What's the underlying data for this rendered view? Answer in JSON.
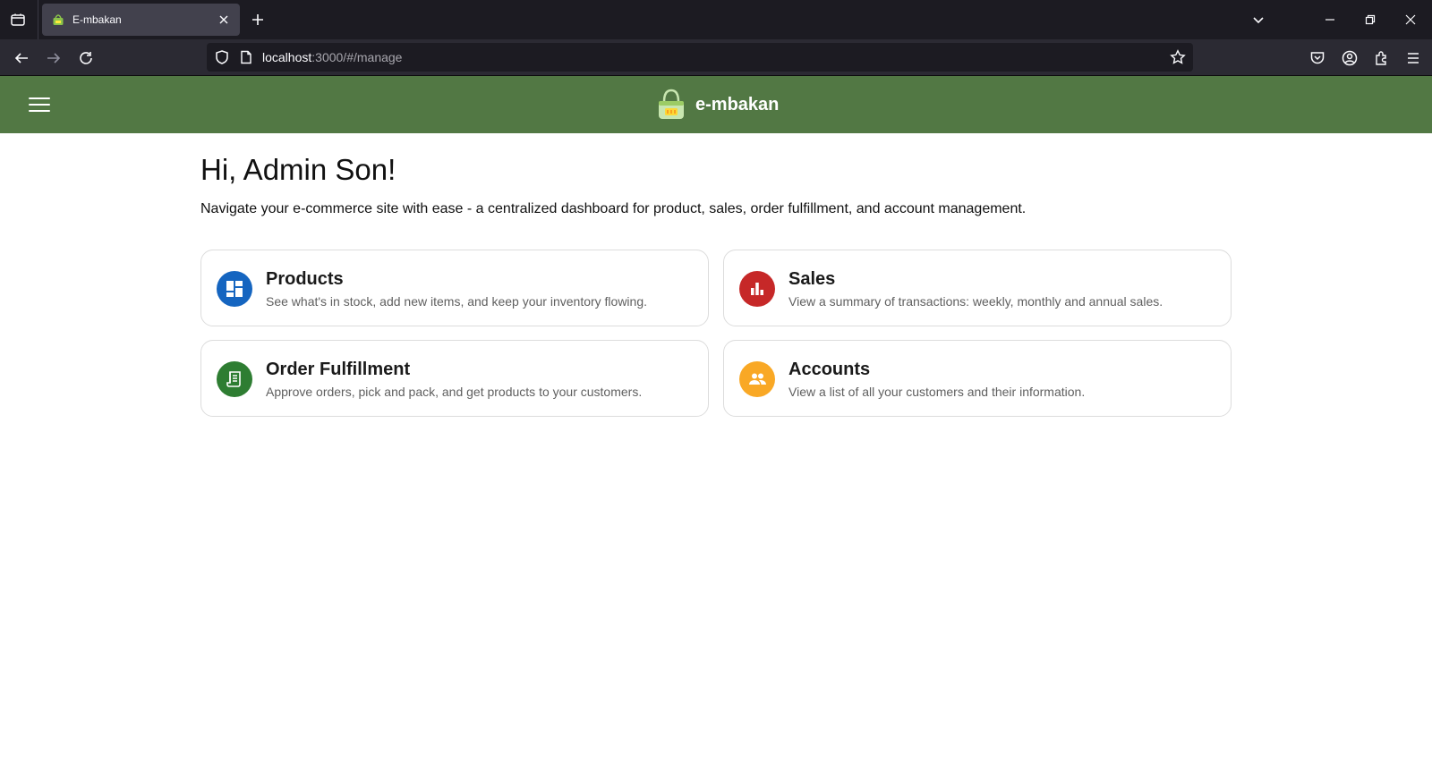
{
  "browser": {
    "tab": {
      "title": "E-mbakan"
    },
    "url": {
      "host": "localhost",
      "rest": ":3000/#/manage"
    }
  },
  "header": {
    "brand": "e-mbakan",
    "accent": "#527844"
  },
  "main": {
    "greeting": "Hi, Admin Son!",
    "subtitle": "Navigate your e-commerce site with ease - a centralized dashboard for product, sales, order fulfillment, and account management.",
    "cards": [
      {
        "title": "Products",
        "desc": "See what's in stock, add new items, and keep your inventory flowing.",
        "icon": "dashboard-icon",
        "color": "#1565c0"
      },
      {
        "title": "Sales",
        "desc": "View a summary of transactions: weekly, monthly and annual sales.",
        "icon": "bar-chart-icon",
        "color": "#c62828"
      },
      {
        "title": "Order Fulfillment",
        "desc": "Approve orders, pick and pack, and get products to your customers.",
        "icon": "receipt-icon",
        "color": "#2e7d32"
      },
      {
        "title": "Accounts",
        "desc": "View a list of all your customers and their information.",
        "icon": "people-icon",
        "color": "#f9a825"
      }
    ]
  }
}
